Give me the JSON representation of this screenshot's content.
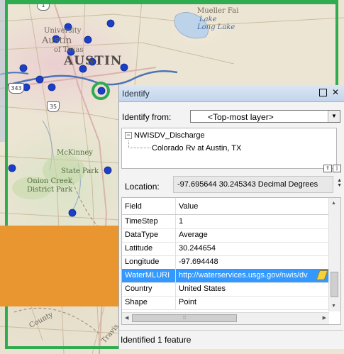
{
  "map": {
    "labels": {
      "austin_big": "AUSTIN",
      "austin_small": "Austin",
      "university": "University",
      "of_texas": "of Texas",
      "lake": "Lake",
      "highway_35": "35",
      "highway_1": "1",
      "highway_343": "343",
      "mueller": "Mueller Fai",
      "long_lake": "Long Lake",
      "mckinney": "McKinney",
      "state_park": "State Park",
      "union_creek": "Onion Creek",
      "district_park": "District Park",
      "county": "County",
      "travis": "Travis"
    },
    "colors": {
      "station_dot": "#1a3fc8",
      "river": "#4a74b8",
      "frame": "#2fac4f",
      "overlay": "#ea9630"
    }
  },
  "identify": {
    "title": "Identify",
    "identify_from_label": "Identify from:",
    "layer_value": "<Top-most layer>",
    "tree": {
      "layer": "NWISDV_Discharge",
      "feature": "Colorado Rv at Austin, TX"
    },
    "location_label": "Location:",
    "location_value": "-97.695644  30.245343 Decimal Degrees",
    "columns": {
      "field": "Field",
      "value": "Value"
    },
    "rows": [
      {
        "field": "TimeStep",
        "value": "1"
      },
      {
        "field": "DataType",
        "value": "Average"
      },
      {
        "field": "Latitude",
        "value": "30.244654"
      },
      {
        "field": "Longitude",
        "value": "-97.694448"
      },
      {
        "field": "WaterMLURI",
        "value": "http://waterservices.usgs.gov/nwis/dv"
      },
      {
        "field": "Country",
        "value": "United States"
      },
      {
        "field": "Shape",
        "value": "Point"
      }
    ],
    "status": "Identified 1 feature"
  }
}
